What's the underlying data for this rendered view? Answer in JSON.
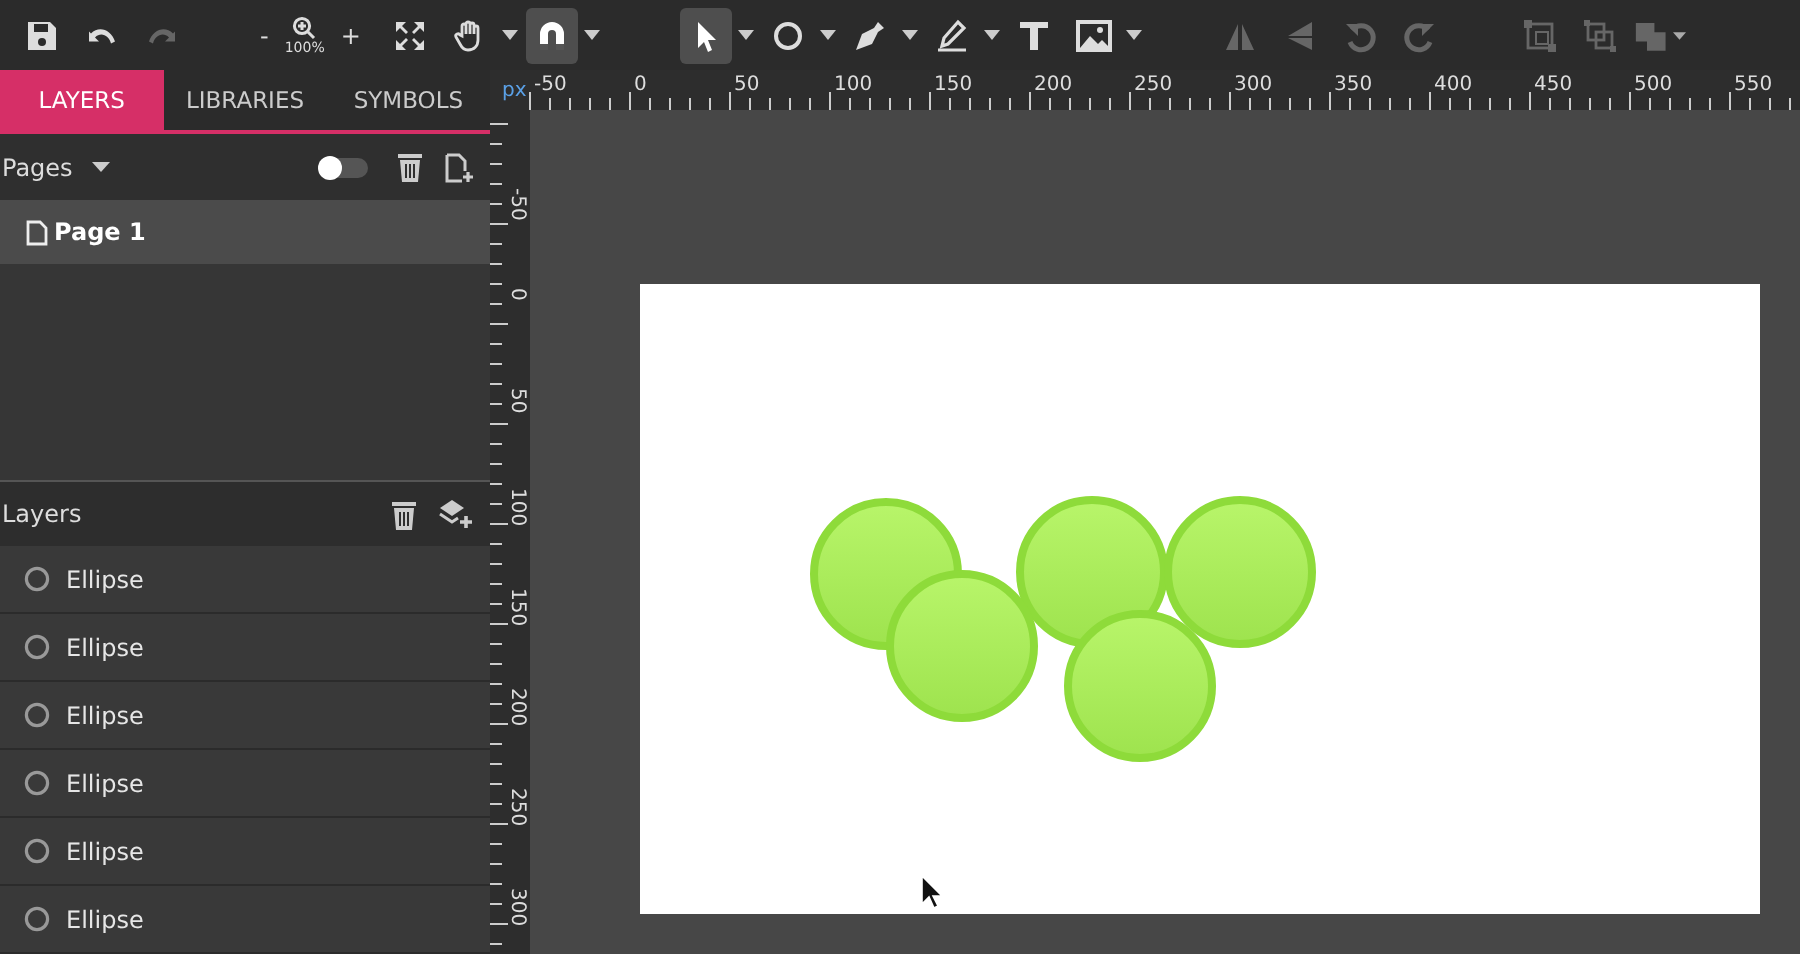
{
  "toolbar": {
    "file_actions": [
      {
        "kind": "save",
        "disabled": false
      },
      {
        "kind": "undo",
        "disabled": false
      },
      {
        "kind": "redo",
        "disabled": true
      }
    ],
    "zoom": {
      "out": "-",
      "level": "100%",
      "in": "+"
    },
    "tools": [
      {
        "kind": "fit",
        "selected": false,
        "dropdown": false
      },
      {
        "kind": "hand",
        "selected": false,
        "dropdown": true
      },
      {
        "kind": "magnet",
        "selected": true,
        "dropdown": true
      },
      {
        "kind": "select",
        "selected": true,
        "dropdown": true
      },
      {
        "kind": "ellipse",
        "selected": false,
        "dropdown": true
      },
      {
        "kind": "pen",
        "selected": false,
        "dropdown": true
      },
      {
        "kind": "pencil",
        "selected": false,
        "dropdown": true
      },
      {
        "kind": "text",
        "selected": false,
        "dropdown": false
      },
      {
        "kind": "image",
        "selected": false,
        "dropdown": true
      }
    ],
    "transform_actions": [
      {
        "kind": "flip-h",
        "disabled": true
      },
      {
        "kind": "flip-v",
        "disabled": true
      },
      {
        "kind": "rotate-left",
        "disabled": true
      },
      {
        "kind": "rotate-right",
        "disabled": true
      }
    ],
    "group_actions": [
      {
        "kind": "group",
        "disabled": true
      },
      {
        "kind": "ungroup",
        "disabled": true
      },
      {
        "kind": "arrange",
        "disabled": true
      }
    ]
  },
  "tabs": [
    {
      "label": "LAYERS",
      "selected": true
    },
    {
      "label": "LIBRARIES",
      "selected": false
    },
    {
      "label": "SYMBOLS",
      "selected": false
    }
  ],
  "pages": {
    "title": "Pages",
    "toggle_on": false,
    "items": [
      {
        "label": "Page 1",
        "selected": true
      }
    ]
  },
  "layers": {
    "title": "Layers",
    "items": [
      {
        "label": "Ellipse"
      },
      {
        "label": "Ellipse"
      },
      {
        "label": "Ellipse"
      },
      {
        "label": "Ellipse"
      },
      {
        "label": "Ellipse"
      },
      {
        "label": "Ellipse"
      }
    ]
  },
  "ruler": {
    "unit": "px",
    "top_labels": [
      "-50",
      "0",
      "50",
      "100",
      "150",
      "200",
      "250",
      "300",
      "350",
      "400",
      "450",
      "500",
      "550"
    ],
    "left_labels": [
      "-50",
      "0",
      "50",
      "100",
      "150",
      "200",
      "250",
      "300"
    ]
  }
}
